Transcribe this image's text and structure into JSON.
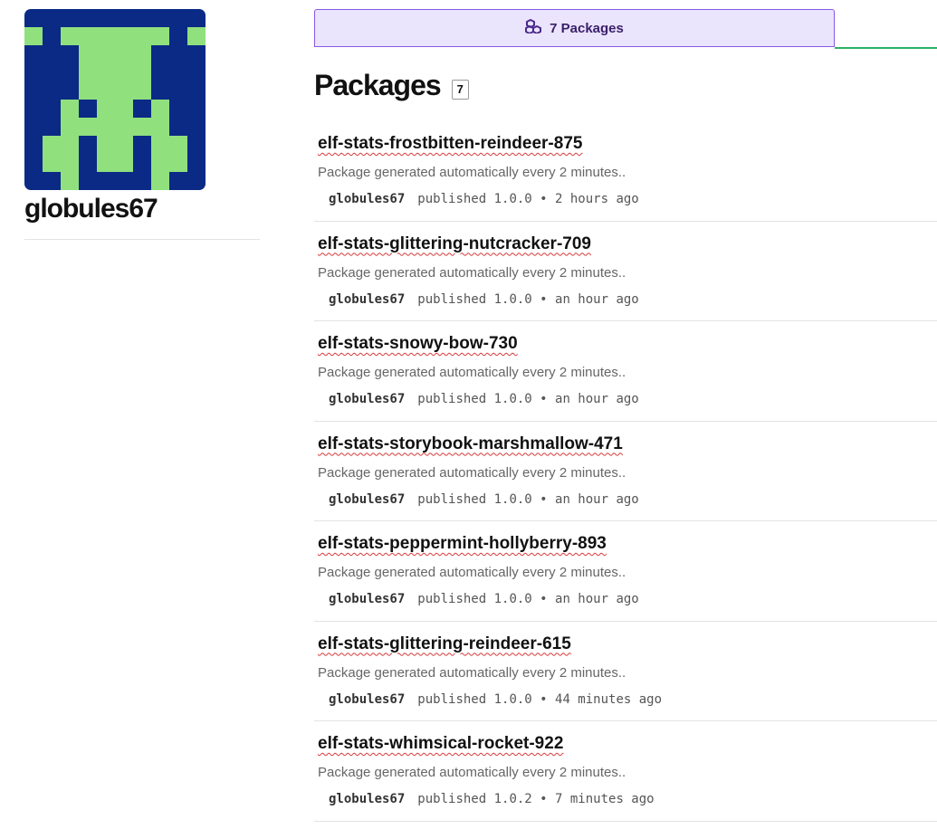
{
  "user": {
    "username": "globules67"
  },
  "tabs": {
    "active_label": "7 Packages"
  },
  "packages_section": {
    "title": "Packages",
    "count": "7"
  },
  "colors": {
    "avatar_bg": "#0a2a86",
    "avatar_fg": "#90e07e",
    "tab_bg": "#eae4fd",
    "tab_border": "#8957e5",
    "tab_accent": "#29b366"
  },
  "packages": [
    {
      "name": "elf-stats-frostbitten-reindeer-875",
      "description": "Package generated automatically every 2 minutes..",
      "author": "globules67",
      "meta": "published 1.0.0 • 2 hours ago"
    },
    {
      "name": "elf-stats-glittering-nutcracker-709",
      "description": "Package generated automatically every 2 minutes..",
      "author": "globules67",
      "meta": "published 1.0.0 • an hour ago"
    },
    {
      "name": "elf-stats-snowy-bow-730",
      "description": "Package generated automatically every 2 minutes..",
      "author": "globules67",
      "meta": "published 1.0.0 • an hour ago"
    },
    {
      "name": "elf-stats-storybook-marshmallow-471",
      "description": "Package generated automatically every 2 minutes..",
      "author": "globules67",
      "meta": "published 1.0.0 • an hour ago"
    },
    {
      "name": "elf-stats-peppermint-hollyberry-893",
      "description": "Package generated automatically every 2 minutes..",
      "author": "globules67",
      "meta": "published 1.0.0 • an hour ago"
    },
    {
      "name": "elf-stats-glittering-reindeer-615",
      "description": "Package generated automatically every 2 minutes..",
      "author": "globules67",
      "meta": "published 1.0.0 • 44 minutes ago"
    },
    {
      "name": "elf-stats-whimsical-rocket-922",
      "description": "Package generated automatically every 2 minutes..",
      "author": "globules67",
      "meta": "published 1.0.2 • 7 minutes ago"
    }
  ]
}
